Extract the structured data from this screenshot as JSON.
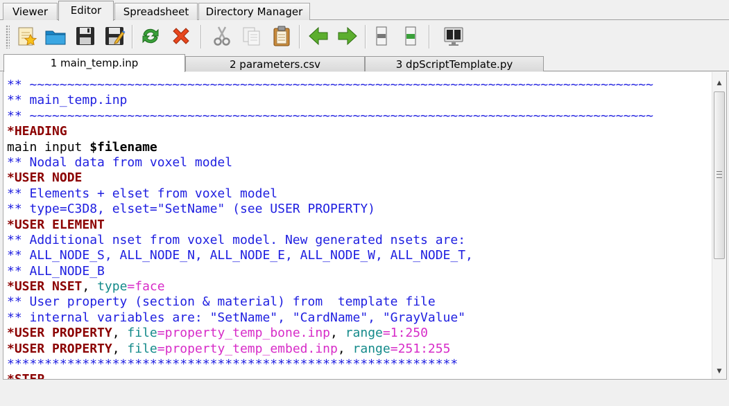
{
  "top_tabs": [
    {
      "label": "Viewer",
      "active": false
    },
    {
      "label": "Editor",
      "active": true
    },
    {
      "label": "Spreadsheet",
      "active": false
    },
    {
      "label": "Directory Manager",
      "active": false
    }
  ],
  "toolbar": {
    "buttons": [
      "new-file-icon",
      "open-folder-icon",
      "save-icon",
      "save-as-icon",
      "reload-icon",
      "close-icon",
      "cut-icon",
      "copy-icon",
      "paste-icon",
      "back-arrow-icon",
      "forward-arrow-icon",
      "indent-left-icon",
      "indent-right-icon",
      "split-view-icon"
    ]
  },
  "file_tabs": [
    {
      "label": "1 main_temp.inp",
      "active": true
    },
    {
      "label": "2 parameters.csv",
      "active": false
    },
    {
      "label": "3 dpScriptTemplate.py",
      "active": false
    }
  ],
  "editor": {
    "lines": [
      [
        {
          "s": "c",
          "t": "** ~~~~~~~~~~~~~~~~~~~~~~~~~~~~~~~~~~~~~~~~~~~~~~~~~~~~~~~~~~~~~~~~~~~~~~~~~~~~~~~~~~~"
        }
      ],
      [
        {
          "s": "c",
          "t": "** main_temp.inp"
        }
      ],
      [
        {
          "s": "c",
          "t": "** ~~~~~~~~~~~~~~~~~~~~~~~~~~~~~~~~~~~~~~~~~~~~~~~~~~~~~~~~~~~~~~~~~~~~~~~~~~~~~~~~~~~"
        }
      ],
      [
        {
          "s": "k",
          "t": "*HEADING"
        }
      ],
      [
        {
          "s": "t",
          "t": "main input "
        },
        {
          "s": "v",
          "t": "$filename"
        }
      ],
      [
        {
          "s": "c",
          "t": "** Nodal data from voxel model"
        }
      ],
      [
        {
          "s": "k",
          "t": "*USER NODE"
        }
      ],
      [
        {
          "s": "c",
          "t": "** Elements + elset from voxel model"
        }
      ],
      [
        {
          "s": "c",
          "t": "** type=C3D8, elset=\"SetName\" (see USER PROPERTY)"
        }
      ],
      [
        {
          "s": "k",
          "t": "*USER ELEMENT"
        }
      ],
      [
        {
          "s": "c",
          "t": "** Additional nset from voxel model. New generated nsets are:"
        }
      ],
      [
        {
          "s": "c",
          "t": "** ALL_NODE_S, ALL_NODE_N, ALL_NODE_E, ALL_NODE_W, ALL_NODE_T,"
        }
      ],
      [
        {
          "s": "c",
          "t": "** ALL_NODE_B"
        }
      ],
      [
        {
          "s": "k",
          "t": "*USER NSET"
        },
        {
          "s": "t",
          "t": ", "
        },
        {
          "s": "a",
          "t": "type"
        },
        {
          "s": "p",
          "t": "=face"
        }
      ],
      [
        {
          "s": "c",
          "t": "** User property (section & material) from  template file"
        }
      ],
      [
        {
          "s": "c",
          "t": "** internal variables are: \"SetName\", \"CardName\", \"GrayValue\""
        }
      ],
      [
        {
          "s": "k",
          "t": "*USER PROPERTY"
        },
        {
          "s": "t",
          "t": ", "
        },
        {
          "s": "a",
          "t": "file"
        },
        {
          "s": "p",
          "t": "=property_temp_bone.inp"
        },
        {
          "s": "t",
          "t": ", "
        },
        {
          "s": "a",
          "t": "range"
        },
        {
          "s": "p",
          "t": "=1:250"
        }
      ],
      [
        {
          "s": "k",
          "t": "*USER PROPERTY"
        },
        {
          "s": "t",
          "t": ", "
        },
        {
          "s": "a",
          "t": "file"
        },
        {
          "s": "p",
          "t": "=property_temp_embed.inp"
        },
        {
          "s": "t",
          "t": ", "
        },
        {
          "s": "a",
          "t": "range"
        },
        {
          "s": "p",
          "t": "=251:255"
        }
      ],
      [
        {
          "s": "c",
          "t": "************************************************************"
        }
      ],
      [
        {
          "s": "k",
          "t": "*STEP"
        }
      ]
    ]
  }
}
